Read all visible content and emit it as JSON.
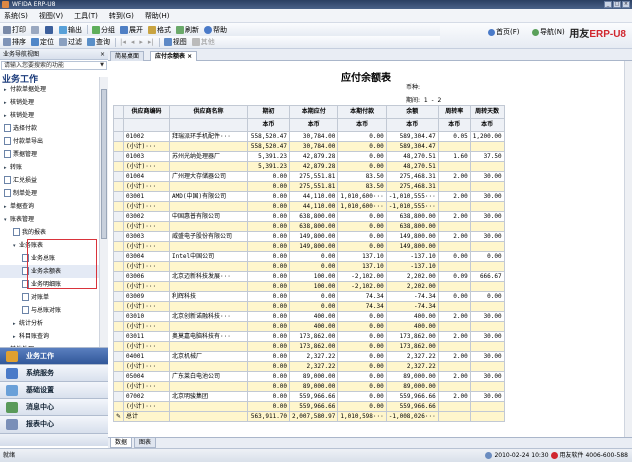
{
  "window": {
    "title": "WFIDA ERP-U8"
  },
  "menu": [
    "系统(S)",
    "视图(V)",
    "工具(T)",
    "转到(G)",
    "帮助(H)"
  ],
  "toolbar1": [
    "打印",
    "",
    "输出",
    "分组",
    "展开",
    "格式",
    "刷新",
    "帮助"
  ],
  "toolbar2": [
    "排序",
    "定位",
    "过滤",
    "查询",
    "",
    "",
    "",
    "",
    "",
    "视图",
    "其他"
  ],
  "brand": {
    "home": "首页(F)",
    "nav": "导航(N)",
    "logo_a": "用友",
    "logo_b": "ERP-U8"
  },
  "left": {
    "header": "业务导航视图",
    "close": "×",
    "search_placeholder": "请输入您要搜索的功能",
    "title": "业务工作",
    "tree": [
      {
        "label": "付款单据处理",
        "lv": 1,
        "kind": "folder"
      },
      {
        "label": "核销处理",
        "lv": 1,
        "kind": "folder"
      },
      {
        "label": "核销处理",
        "lv": 1,
        "kind": "folder"
      },
      {
        "label": "选择付款",
        "lv": 1,
        "kind": "file"
      },
      {
        "label": "付款单导出",
        "lv": 1,
        "kind": "file"
      },
      {
        "label": "票据管理",
        "lv": 1,
        "kind": "file"
      },
      {
        "label": "转账",
        "lv": 1,
        "kind": "folder"
      },
      {
        "label": "汇兑损益",
        "lv": 1,
        "kind": "file"
      },
      {
        "label": "制单处理",
        "lv": 1,
        "kind": "file"
      },
      {
        "label": "单据查询",
        "lv": 1,
        "kind": "folder"
      },
      {
        "label": "账表管理",
        "lv": 1,
        "kind": "folder-open"
      },
      {
        "label": "我的报表",
        "lv": 2,
        "kind": "file"
      },
      {
        "label": "业务账表",
        "lv": 2,
        "kind": "folder-open"
      },
      {
        "label": "业务总账",
        "lv": 3,
        "kind": "file"
      },
      {
        "label": "业务余额表",
        "lv": 3,
        "kind": "file",
        "sel": true
      },
      {
        "label": "业务明细账",
        "lv": 3,
        "kind": "file"
      },
      {
        "label": "对账单",
        "lv": 3,
        "kind": "file"
      },
      {
        "label": "与总账对账",
        "lv": 3,
        "kind": "file"
      },
      {
        "label": "统计分析",
        "lv": 2,
        "kind": "folder"
      },
      {
        "label": "科目账查询",
        "lv": 2,
        "kind": "folder"
      },
      {
        "label": "其他处理",
        "lv": 1,
        "kind": "folder"
      }
    ],
    "bottom": [
      {
        "label": "业务工作",
        "active": true
      },
      {
        "label": "系统服务"
      },
      {
        "label": "基础设置"
      },
      {
        "label": "消息中心"
      },
      {
        "label": "报表中心"
      }
    ]
  },
  "tabs": [
    "简易桌面",
    "应付余额表"
  ],
  "tab_close": "×",
  "report": {
    "title": "应付余额表",
    "currency_label": "币种:",
    "period_label": "期间:",
    "period_from": "1",
    "period_sep": "-",
    "period_to": "2",
    "headers": [
      "供应商编码",
      "供应商名称",
      "期初",
      "本期应付",
      "本期付款",
      "余额",
      "周转率",
      "周转天数"
    ],
    "subheaders": [
      "",
      "",
      "本币",
      "本币",
      "本币",
      "本币",
      "本币",
      "本币"
    ],
    "rows": [
      [
        "01002",
        "拜瑞派环手机配件···",
        "558,520.47",
        "30,784.00",
        "0.00",
        "589,304.47",
        "0.05",
        "1,200.00",
        ""
      ],
      [
        "(小计)···",
        "",
        "558,520.47",
        "30,784.00",
        "0.00",
        "589,304.47",
        "",
        "",
        "sub"
      ],
      [
        "01003",
        "苏州光纳处理器厂",
        "5,391.23",
        "42,879.28",
        "0.00",
        "48,270.51",
        "1.60",
        "37.50",
        ""
      ],
      [
        "(小计)···",
        "",
        "5,391.23",
        "42,879.28",
        "0.00",
        "48,270.51",
        "",
        "",
        "sub"
      ],
      [
        "01004",
        "广州理大存储器公司",
        "0.00",
        "275,551.81",
        "83.50",
        "275,468.31",
        "2.00",
        "30.00",
        ""
      ],
      [
        "(小计)···",
        "",
        "0.00",
        "275,551.81",
        "83.50",
        "275,468.31",
        "",
        "",
        "sub"
      ],
      [
        "03001",
        "AMD(中国)有限公司",
        "0.00",
        "44,110.00",
        "1,010,600···",
        "-1,010,555···",
        "2.00",
        "30.00",
        ""
      ],
      [
        "(小计)···",
        "",
        "0.00",
        "44,110.00",
        "1,010,600···",
        "-1,010,555···",
        "",
        "",
        "sub"
      ],
      [
        "03002",
        "中国惠普有限公司",
        "0.00",
        "638,800.00",
        "0.00",
        "638,800.00",
        "2.00",
        "30.00",
        ""
      ],
      [
        "(小计)···",
        "",
        "0.00",
        "638,800.00",
        "0.00",
        "638,800.00",
        "",
        "",
        "sub"
      ],
      [
        "03003",
        "威盛电子股份有限公司",
        "0.00",
        "149,800.00",
        "0.00",
        "149,800.00",
        "2.00",
        "30.00",
        ""
      ],
      [
        "(小计)···",
        "",
        "0.00",
        "149,800.00",
        "0.00",
        "149,800.00",
        "",
        "",
        "sub"
      ],
      [
        "03004",
        "Intel中国公司",
        "0.00",
        "0.00",
        "137.10",
        "-137.10",
        "0.00",
        "0.00",
        ""
      ],
      [
        "(小计)···",
        "",
        "0.00",
        "0.00",
        "137.10",
        "-137.10",
        "",
        "",
        "sub"
      ],
      [
        "03006",
        "北京迈新科技发展···",
        "0.00",
        "100.00",
        "-2,102.00",
        "2,202.00",
        "0.09",
        "666.67",
        ""
      ],
      [
        "(小计)···",
        "",
        "0.00",
        "100.00",
        "-2,102.00",
        "2,202.00",
        "",
        "",
        "sub"
      ],
      [
        "03009",
        "利辉科技",
        "0.00",
        "0.00",
        "74.34",
        "-74.34",
        "0.00",
        "0.00",
        ""
      ],
      [
        "(小计)···",
        "",
        "0.00",
        "0.00",
        "74.34",
        "-74.34",
        "",
        "",
        "sub"
      ],
      [
        "03010",
        "北京创新诺融科技···",
        "0.00",
        "400.00",
        "0.00",
        "400.00",
        "2.00",
        "30.00",
        ""
      ],
      [
        "(小计)···",
        "",
        "0.00",
        "400.00",
        "0.00",
        "400.00",
        "",
        "",
        "sub"
      ],
      [
        "03011",
        "奥莫嘉电脑科技有···",
        "0.00",
        "173,862.00",
        "0.00",
        "173,862.00",
        "2.00",
        "30.00",
        ""
      ],
      [
        "(小计)···",
        "",
        "0.00",
        "173,862.00",
        "0.00",
        "173,862.00",
        "",
        "",
        "sub"
      ],
      [
        "04001",
        "北京机械厂",
        "0.00",
        "2,327.22",
        "0.00",
        "2,327.22",
        "2.00",
        "30.00",
        ""
      ],
      [
        "(小计)···",
        "",
        "0.00",
        "2,327.22",
        "0.00",
        "2,327.22",
        "",
        "",
        "sub"
      ],
      [
        "05004",
        "广东莱白电池公司",
        "0.00",
        "89,000.00",
        "0.00",
        "89,000.00",
        "2.00",
        "30.00",
        ""
      ],
      [
        "(小计)···",
        "",
        "0.00",
        "89,000.00",
        "0.00",
        "89,000.00",
        "",
        "",
        "sub"
      ],
      [
        "07002",
        "北京明骏集团",
        "0.00",
        "559,966.66",
        "0.00",
        "559,966.66",
        "2.00",
        "30.00",
        ""
      ],
      [
        "(小计)···",
        "",
        "0.00",
        "559,966.66",
        "0.00",
        "559,966.66",
        "",
        "",
        "sub"
      ],
      [
        "总计",
        "",
        "563,911.70",
        "2,007,580.97",
        "1,010,598···",
        "-1,008,026···",
        "",
        "",
        "tot"
      ]
    ]
  },
  "bottom_tabs": [
    "数据",
    "图表"
  ],
  "status": {
    "left": "就绪",
    "datetime": "2010-02-24 10:30",
    "company": "用友软件",
    "phone": "4006-600-588"
  },
  "colors": {
    "accent": "#2f5597",
    "subtotal_bg": "#fff6cc",
    "highlight_border": "#d9333b",
    "brand_red": "#d0262e"
  }
}
